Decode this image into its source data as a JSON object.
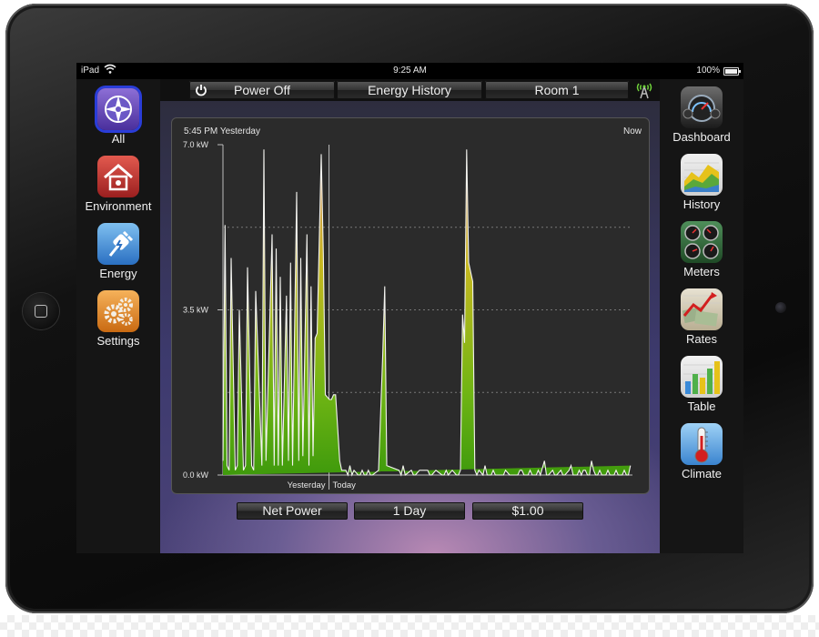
{
  "status_bar": {
    "device": "iPad",
    "time": "9:25 AM",
    "battery": "100%",
    "battery_level": 1.0
  },
  "left_nav": [
    {
      "label": "All",
      "icon": "compass-icon",
      "selected": true
    },
    {
      "label": "Environment",
      "icon": "house-icon",
      "selected": false
    },
    {
      "label": "Energy",
      "icon": "plug-icon",
      "selected": false
    },
    {
      "label": "Settings",
      "icon": "gears-icon",
      "selected": false
    }
  ],
  "right_nav": [
    {
      "label": "Dashboard",
      "icon": "gauge-icon"
    },
    {
      "label": "History",
      "icon": "area-chart-icon"
    },
    {
      "label": "Meters",
      "icon": "meters-icon"
    },
    {
      "label": "Rates",
      "icon": "rates-icon"
    },
    {
      "label": "Table",
      "icon": "bar-chart-icon"
    },
    {
      "label": "Climate",
      "icon": "thermometer-icon"
    }
  ],
  "top_bar": {
    "power_label": "Power Off",
    "title": "Energy History",
    "room": "Room 1",
    "signal_icon": "antenna-icon"
  },
  "bottom_bar": {
    "metric": "Net Power",
    "range": "1 Day",
    "rate": "$1.00"
  },
  "colors": {
    "accent": "#2a3dd8",
    "series_low": "#4fa80f",
    "series_mid": "#c8b820",
    "series_high": "#d48a6a"
  },
  "chart_data": {
    "type": "area",
    "start_label": "5:45 PM Yesterday",
    "end_label": "Now",
    "y_ticks": [
      "0.0 kW",
      "3.5 kW",
      "7.0 kW"
    ],
    "ylim": [
      0,
      7.0
    ],
    "x_labels": [
      "Yesterday",
      "Today"
    ],
    "grid": true,
    "series": [
      {
        "t": [
          0.0,
          0.005,
          0.01,
          0.015,
          0.02,
          0.03,
          0.035,
          0.04,
          0.05,
          0.055,
          0.06,
          0.07,
          0.075,
          0.08,
          0.095,
          0.1,
          0.105,
          0.12,
          0.125,
          0.13,
          0.135,
          0.14,
          0.145,
          0.155,
          0.16,
          0.165,
          0.17,
          0.18,
          0.185,
          0.19,
          0.195,
          0.205,
          0.21,
          0.215,
          0.22,
          0.225,
          0.23,
          0.24,
          0.245,
          0.25,
          0.26,
          0.265,
          0.27,
          0.275,
          0.285,
          0.29,
          0.3,
          0.305,
          0.31,
          0.315,
          0.32,
          0.33,
          0.335,
          0.34,
          0.345,
          0.35,
          0.355,
          0.36,
          0.365,
          0.38,
          0.39,
          0.395,
          0.4,
          0.43,
          0.435,
          0.44,
          0.445,
          0.46,
          0.465,
          0.47,
          0.48,
          0.5,
          0.505,
          0.51,
          0.52,
          0.535,
          0.54,
          0.545,
          0.55,
          0.56,
          0.57,
          0.575,
          0.58,
          0.585,
          0.59,
          0.595,
          0.6,
          0.61,
          0.615,
          0.62,
          0.625,
          0.635,
          0.64,
          0.645,
          0.655,
          0.66,
          0.665,
          0.68,
          0.685,
          0.69,
          0.7,
          0.705,
          0.71,
          0.72,
          0.725,
          0.73,
          0.735,
          0.745,
          0.75,
          0.755,
          0.765,
          0.77,
          0.775,
          0.785,
          0.79,
          0.795,
          0.805,
          0.81,
          0.815,
          0.825,
          0.83,
          0.835,
          0.845,
          0.85,
          0.855,
          0.865,
          0.87,
          0.875,
          0.88,
          0.885,
          0.89,
          0.895,
          0.9,
          0.905,
          0.91,
          0.915,
          0.92,
          0.925,
          0.93,
          0.935,
          0.94,
          0.945,
          0.95,
          0.955,
          0.96,
          0.965,
          0.97,
          0.975,
          0.98,
          0.985,
          0.99,
          0.995,
          1.0
        ],
        "kw": [
          0.3,
          5.3,
          0.2,
          0.1,
          4.6,
          0.1,
          0.2,
          3.5,
          0.1,
          0.2,
          4.4,
          0.2,
          0.1,
          3.9,
          0.2,
          6.9,
          0.3,
          5.1,
          0.2,
          4.8,
          0.2,
          4.2,
          0.2,
          3.8,
          0.3,
          4.5,
          0.2,
          6.0,
          0.3,
          4.6,
          0.4,
          5.1,
          0.2,
          4.0,
          0.4,
          2.9,
          3.0,
          6.8,
          4.7,
          1.7,
          1.6,
          1.6,
          1.7,
          1.7,
          0.3,
          0.1,
          0.1,
          0.0,
          0.2,
          0.0,
          0.1,
          0.0,
          0.0,
          0.1,
          0.0,
          0.0,
          0.1,
          0.0,
          0.0,
          0.1,
          2.5,
          4.0,
          0.2,
          0.1,
          0.0,
          0.2,
          0.0,
          0.1,
          0.0,
          0.0,
          0.1,
          0.1,
          0.0,
          0.0,
          0.1,
          0.0,
          0.0,
          0.1,
          0.0,
          0.1,
          0.0,
          0.0,
          0.1,
          3.4,
          2.8,
          6.9,
          4.5,
          4.1,
          0.1,
          0.0,
          0.1,
          0.0,
          0.2,
          0.0,
          0.0,
          0.1,
          0.0,
          0.0,
          0.0,
          0.1,
          0.0,
          0.0,
          0.0,
          0.0,
          0.1,
          0.1,
          0.0,
          0.0,
          0.1,
          0.0,
          0.0,
          0.1,
          0.0,
          0.3,
          0.0,
          0.0,
          0.1,
          0.0,
          0.0,
          0.1,
          0.0,
          0.0,
          0.1,
          0.2,
          0.0,
          0.0,
          0.1,
          0.0,
          0.1,
          0.1,
          0.0,
          0.0,
          0.3,
          0.1,
          0.0,
          0.0,
          0.1,
          0.0,
          0.0,
          0.0,
          0.1,
          0.0,
          0.0,
          0.0,
          0.1,
          0.0,
          0.0,
          0.0,
          0.1,
          0.0,
          0.0,
          0.2
        ]
      }
    ]
  }
}
